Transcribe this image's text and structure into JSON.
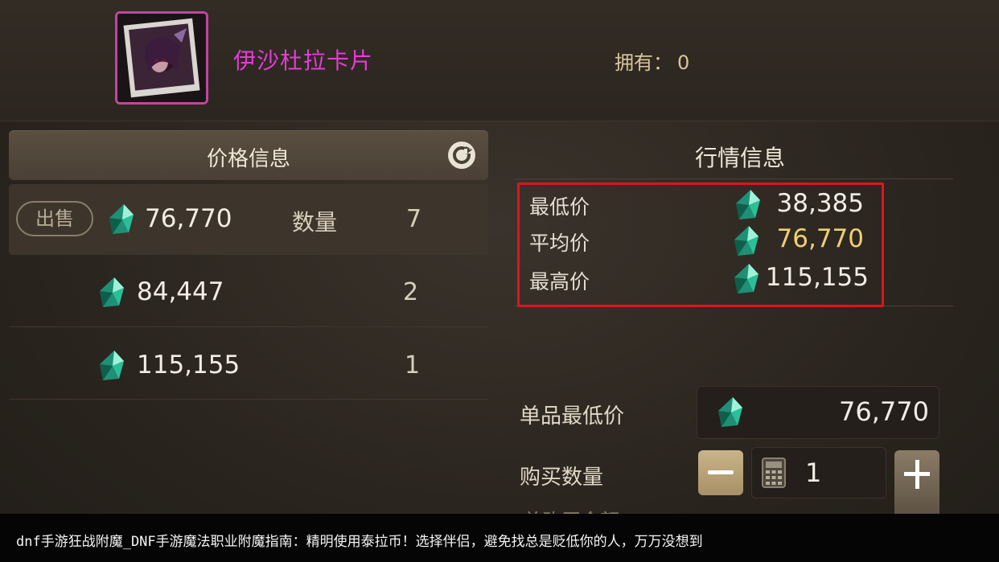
{
  "item": {
    "name": "伊沙杜拉卡片",
    "owned_label": "拥有：",
    "owned_value": "0"
  },
  "price_panel": {
    "title": "价格信息",
    "sell_badge": "出售",
    "qty_header": "数量",
    "rows": [
      {
        "price": "76,770",
        "qty": "7"
      },
      {
        "price": "84,447",
        "qty": "2"
      },
      {
        "price": "115,155",
        "qty": "1"
      }
    ]
  },
  "market_panel": {
    "title": "行情信息",
    "stats": [
      {
        "label": "最低价",
        "value": "38,385",
        "color": "#f2ede4"
      },
      {
        "label": "平均价",
        "value": "76,770",
        "color": "#f0cf74"
      },
      {
        "label": "最高价",
        "value": "115,155",
        "color": "#f2ede4"
      }
    ],
    "highlight_color": "#e0141c"
  },
  "purchase": {
    "unit_price_label": "单品最低价",
    "unit_price_value": "76,770",
    "quantity_label": "购买数量",
    "quantity_value": "1",
    "total_label": "总购买金额"
  },
  "caption": "dnf手游狂战附魔_DNF手游魔法职业附魔指南：精明使用泰拉币！选择伴侣，避免找总是贬低你的人，万万没想到",
  "icons": {
    "currency": "gem-icon",
    "refresh": "refresh-icon",
    "calculator": "calculator-icon"
  }
}
